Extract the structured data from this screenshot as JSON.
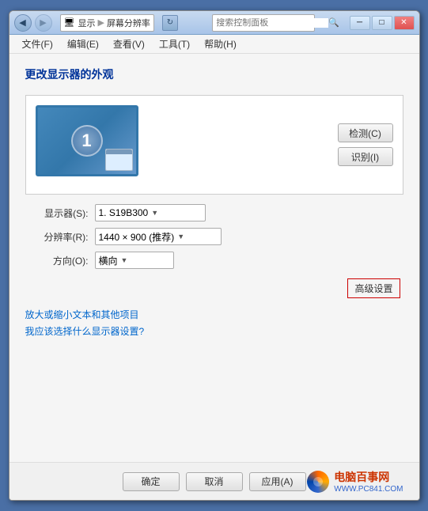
{
  "window": {
    "title": "屏幕分辨率",
    "titlebar": {
      "minimize": "─",
      "maximize": "□",
      "close": "✕"
    }
  },
  "addressbar": {
    "path1": "显示",
    "path2": "屏幕分辨率",
    "search_placeholder": "搜索控制面板"
  },
  "menubar": {
    "items": [
      {
        "id": "file",
        "label": "文件(F)"
      },
      {
        "id": "edit",
        "label": "编辑(E)"
      },
      {
        "id": "view",
        "label": "查看(V)"
      },
      {
        "id": "tools",
        "label": "工具(T)"
      },
      {
        "id": "help",
        "label": "帮助(H)"
      }
    ]
  },
  "page": {
    "title": "更改显示器的外观",
    "monitor_number": "1",
    "detect_btn": "检测(C)",
    "identify_btn": "识别(I)",
    "display_label": "显示器(S):",
    "display_value": "1. S19B300",
    "resolution_label": "分辨率(R):",
    "resolution_value": "1440 × 900 (推荐)",
    "orientation_label": "方向(O):",
    "orientation_value": "横向",
    "advanced_btn": "高级设置",
    "link1": "放大或缩小文本和其他项目",
    "link2": "我应该选择什么显示器设置?",
    "confirm_btn": "确定",
    "cancel_btn": "取消",
    "apply_btn": "应用(A)"
  },
  "watermark": {
    "name": "电脑百事网",
    "url": "WWW.PC841.COM"
  }
}
